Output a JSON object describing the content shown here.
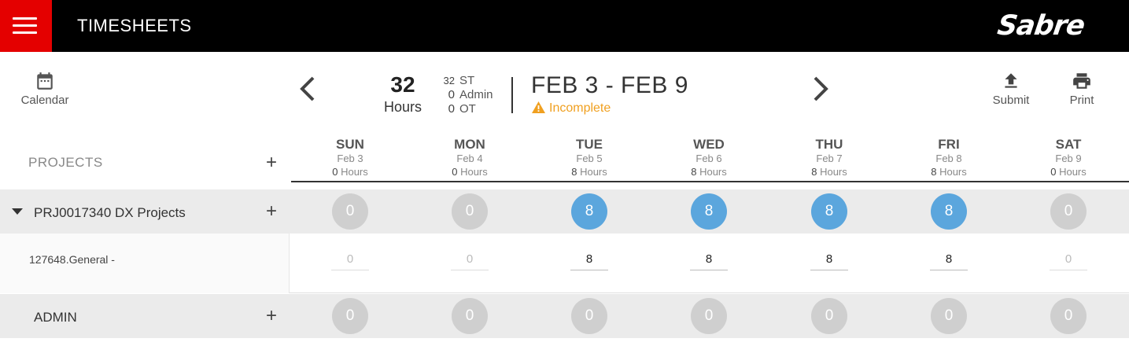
{
  "app": {
    "title": "TIMESHEETS",
    "logo_text": "Sabre",
    "accent": "#e40000",
    "logo_bg": "#000000"
  },
  "header": {
    "calendar_label": "Calendar",
    "submit_label": "Submit",
    "print_label": "Print",
    "total_hours": "32",
    "hours_label": "Hours",
    "breakdown": [
      {
        "value": "32",
        "label": "ST"
      },
      {
        "value": "0",
        "label": "Admin"
      },
      {
        "value": "0",
        "label": "OT"
      }
    ],
    "date_range": "FEB 3 - FEB 9",
    "status": "Incomplete",
    "status_color": "#f0a020"
  },
  "grid": {
    "projects_label": "PROJECTS",
    "hours_word": "Hours",
    "days": [
      {
        "name": "SUN",
        "date": "Feb 3",
        "hours": "0"
      },
      {
        "name": "MON",
        "date": "Feb 4",
        "hours": "0"
      },
      {
        "name": "TUE",
        "date": "Feb 5",
        "hours": "8"
      },
      {
        "name": "WED",
        "date": "Feb 6",
        "hours": "8"
      },
      {
        "name": "THU",
        "date": "Feb 7",
        "hours": "8"
      },
      {
        "name": "FRI",
        "date": "Feb 8",
        "hours": "8"
      },
      {
        "name": "SAT",
        "date": "Feb 9",
        "hours": "0"
      }
    ],
    "project": {
      "name": "PRJ0017340 DX Projects",
      "totals": [
        "0",
        "0",
        "8",
        "8",
        "8",
        "8",
        "0"
      ],
      "task": {
        "name": "127648.General -",
        "values": [
          "0",
          "0",
          "8",
          "8",
          "8",
          "8",
          "0"
        ]
      }
    },
    "admin": {
      "name": "ADMIN",
      "totals": [
        "0",
        "0",
        "0",
        "0",
        "0",
        "0",
        "0"
      ]
    },
    "active_color": "#5ba6dd",
    "inactive_color": "#cfcfcf"
  }
}
